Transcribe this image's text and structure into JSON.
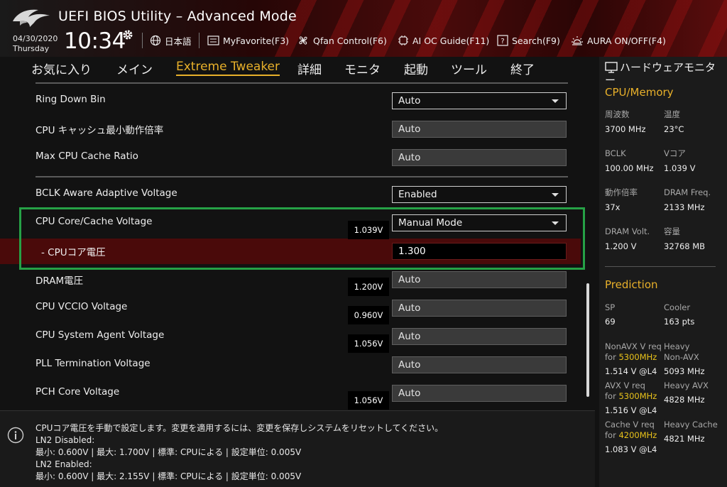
{
  "header": {
    "title": "UEFI BIOS Utility – Advanced Mode",
    "date": "04/30/2020",
    "weekday": "Thursday",
    "time": "10:34",
    "language": "日本語",
    "myfavorite": "MyFavorite(F3)",
    "qfan": "Qfan Control(F6)",
    "aioc": "AI OC Guide(F11)",
    "search": "Search(F9)",
    "aura": "AURA ON/OFF(F4)"
  },
  "tabs": [
    {
      "label": "お気に入り"
    },
    {
      "label": "メイン"
    },
    {
      "label": "Extreme Tweaker",
      "active": true
    },
    {
      "label": "詳細"
    },
    {
      "label": "モニタ"
    },
    {
      "label": "起動"
    },
    {
      "label": "ツール"
    },
    {
      "label": "終了"
    }
  ],
  "settings": [
    {
      "label": "Ring Down Bin",
      "value": "Auto",
      "type": "dropdown"
    },
    {
      "label": "CPU キャッシュ最小動作倍率",
      "value": "Auto",
      "type": "readonly"
    },
    {
      "label": "Max CPU Cache Ratio",
      "value": "Auto",
      "type": "readonly"
    },
    {
      "label": "BCLK Aware Adaptive Voltage",
      "value": "Enabled",
      "type": "dropdown"
    },
    {
      "label": "CPU Core/Cache Voltage",
      "current": "1.039V",
      "value": "Manual Mode",
      "type": "dropdown"
    },
    {
      "label": "- CPUコア電圧",
      "value": "1.300",
      "type": "edit"
    },
    {
      "label": "DRAM電圧",
      "current": "1.200V",
      "value": "Auto",
      "type": "readonly"
    },
    {
      "label": "CPU VCCIO Voltage",
      "current": "0.960V",
      "value": "Auto",
      "type": "readonly"
    },
    {
      "label": "CPU System Agent Voltage",
      "current": "1.056V",
      "value": "Auto",
      "type": "readonly"
    },
    {
      "label": "PLL Termination Voltage",
      "value": "Auto",
      "type": "readonly"
    },
    {
      "label": "PCH Core Voltage",
      "current": "1.056V",
      "value": "Auto",
      "type": "readonly"
    }
  ],
  "help": {
    "lines": [
      "CPUコア電圧を手動で設定します。変更を適用するには、変更を保存しシステムをリセットしてください。",
      "LN2 Disabled:",
      "最小: 0.600V   |   最大: 1.700V   |   標準: CPUによる   |   設定単位: 0.005V",
      "LN2 Enabled:",
      "最小: 0.600V   |   最大: 2.155V   |   標準: CPUによる   |   設定単位: 0.005V"
    ]
  },
  "monitor": {
    "title": "ハードウェアモニター",
    "cpu_section": "CPU/Memory",
    "cpu": [
      {
        "label": "周波数",
        "value": "3700 MHz"
      },
      {
        "label": "温度",
        "value": "23°C"
      },
      {
        "label": "BCLK",
        "value": "100.00 MHz"
      },
      {
        "label": "Vコア",
        "value": "1.039 V"
      },
      {
        "label": "動作倍率",
        "value": "37x"
      },
      {
        "label": "DRAM Freq.",
        "value": "2133 MHz"
      },
      {
        "label": "DRAM Volt.",
        "value": "1.200 V"
      },
      {
        "label": "容量",
        "value": "32768 MB"
      }
    ],
    "prediction_section": "Prediction",
    "prediction": {
      "sp_label": "SP",
      "sp_value": "69",
      "cooler_label": "Cooler",
      "cooler_value": "163 pts",
      "nonavx_label": "NonAVX V req",
      "nonavx_for": "for ",
      "nonavx_freq": "5300MHz",
      "nonavx_value": "1.514 V @L4",
      "heavy_nonavx_label1": "Heavy",
      "heavy_nonavx_label2": "Non-AVX",
      "heavy_nonavx_value": "5093 MHz",
      "avx_label": "AVX V req",
      "avx_for": "for ",
      "avx_freq": "5300MHz",
      "avx_value": "1.516 V @L4",
      "heavy_avx_label": "Heavy AVX",
      "heavy_avx_value": "4828 MHz",
      "cache_label": "Cache V req",
      "cache_for": "for ",
      "cache_freq": "4200MHz",
      "cache_value": "1.083 V @L4",
      "heavy_cache_label": "Heavy Cache",
      "heavy_cache_value": "4821 MHz"
    }
  },
  "colors": {
    "accent": "#e8b02a",
    "highlight_row": "#4a0a0a",
    "focus_box": "#26a146",
    "freq_highlight": "#e8c21a"
  }
}
